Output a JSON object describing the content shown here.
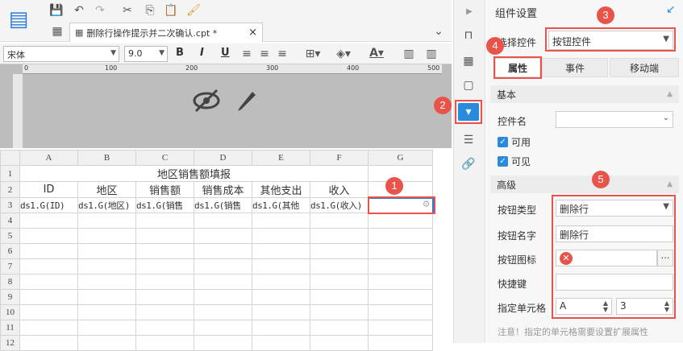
{
  "file_tab": {
    "name": "删除行操作提示并二次确认.cpt *",
    "close": "×"
  },
  "format_bar": {
    "font": "宋体",
    "size": "9.0",
    "bold": "B",
    "italic": "I",
    "underline": "U"
  },
  "ruler": {
    "marks": [
      "0",
      "100",
      "200",
      "300",
      "400",
      "500"
    ]
  },
  "sheet": {
    "columns": [
      "A",
      "B",
      "C",
      "D",
      "E",
      "F",
      "G"
    ],
    "rows": [
      "1",
      "2",
      "3",
      "4",
      "5",
      "6",
      "7",
      "8",
      "9",
      "10",
      "11",
      "12"
    ],
    "title": "地区销售额填报",
    "headers": [
      "ID",
      "地区",
      "销售额",
      "销售成本",
      "其他支出",
      "收入"
    ],
    "data": [
      "ds1.G(ID)",
      "ds1.G(地区)",
      "ds1.G(销售",
      "ds1.G(销售",
      "ds1.G(其他",
      "ds1.G(收入)"
    ]
  },
  "panel": {
    "title": "组件设置",
    "select_label": "选择控件",
    "select_value": "按钮控件",
    "tabs": [
      "属性",
      "事件",
      "移动端"
    ],
    "section_basic": "基本",
    "widget_name_label": "控件名",
    "widget_name_value": "",
    "enabled_label": "可用",
    "visible_label": "可见",
    "section_advanced": "高级",
    "btn_type_label": "按钮类型",
    "btn_type_value": "删除行",
    "btn_name_label": "按钮名字",
    "btn_name_value": "删除行",
    "btn_icon_label": "按钮图标",
    "shortcut_label": "快捷键",
    "shortcut_value": "",
    "cell_label": "指定单元格",
    "cell_col": "A",
    "cell_row": "3",
    "note": "注意！指定的单元格需要设置扩展属性"
  },
  "badges": [
    "1",
    "2",
    "3",
    "4",
    "5"
  ],
  "colors": {
    "accent": "#e8544a",
    "check": "#2a8adb"
  }
}
